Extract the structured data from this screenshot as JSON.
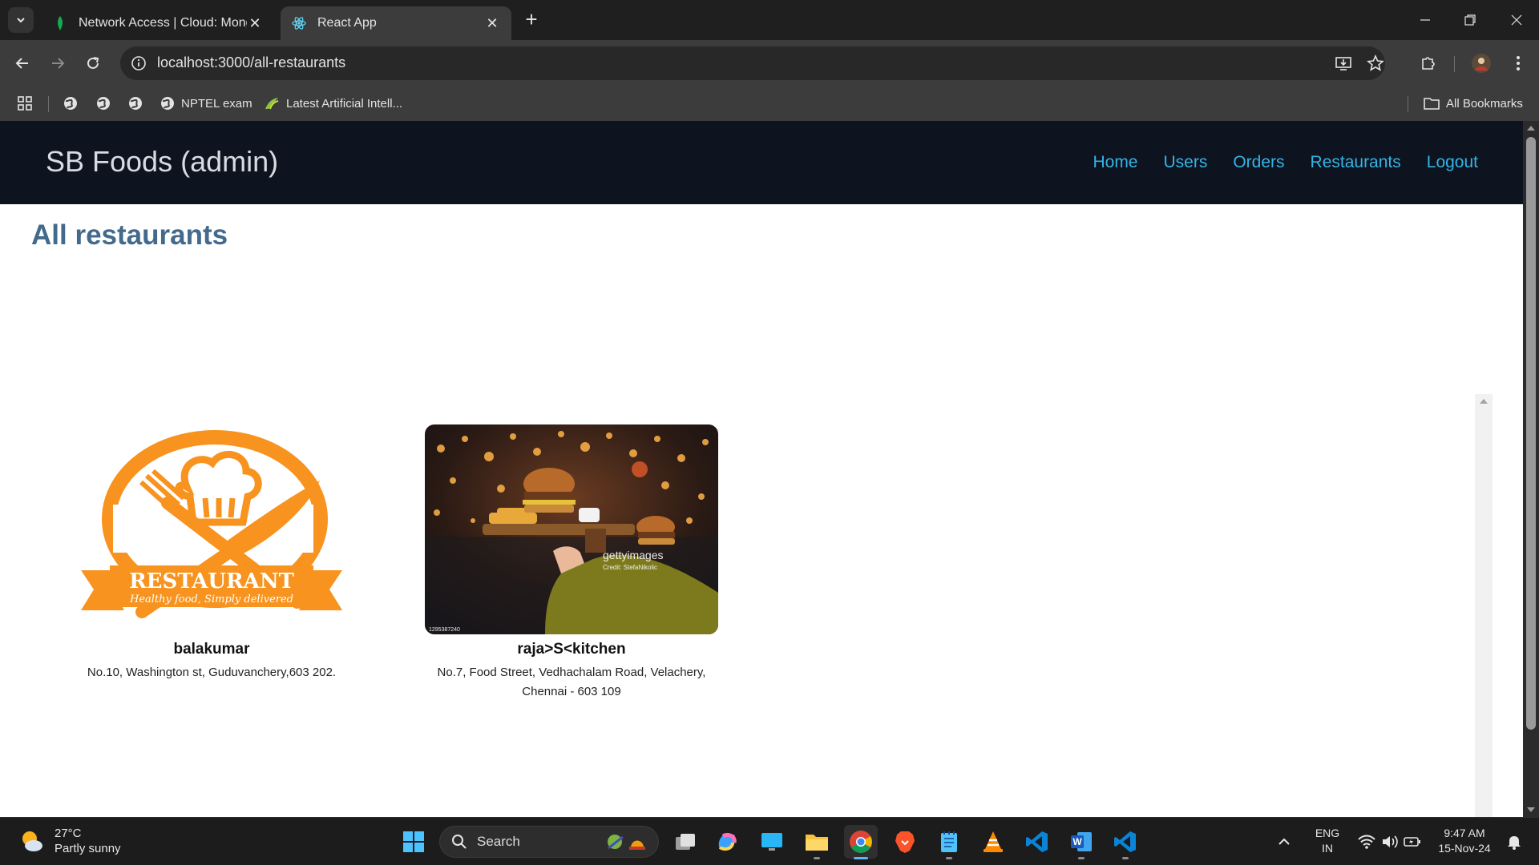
{
  "browser": {
    "tabs": [
      {
        "title": "Network Access | Cloud: MongoDB",
        "active": false
      },
      {
        "title": "React App",
        "active": true
      }
    ],
    "url": "localhost:3000/all-restaurants",
    "bookmarks": [
      {
        "label": ""
      },
      {
        "label": ""
      },
      {
        "label": ""
      },
      {
        "label": "NPTEL exam"
      },
      {
        "label": "Latest Artificial Intell..."
      }
    ],
    "all_bookmarks_label": "All Bookmarks"
  },
  "app": {
    "brand": "SB Foods (admin)",
    "nav": [
      "Home",
      "Users",
      "Orders",
      "Restaurants",
      "Logout"
    ],
    "page_title": "All restaurants",
    "restaurants": [
      {
        "name": "balakumar",
        "address": "No.10, Washington st, Guduvanchery,603 202.",
        "logo_text": "RESTAURANT",
        "logo_tagline": "Healthy food, Simply delivered"
      },
      {
        "name": "raja>S<kitchen",
        "address": "No.7, Food Street, Vedhachalam Road, Velachery, Chennai - 603 109",
        "watermark": "gettyimages",
        "watermark_credit": "Credit: StefaNikolic",
        "image_id": "1295387240"
      }
    ]
  },
  "taskbar": {
    "weather_temp": "27°C",
    "weather_cond": "Partly sunny",
    "search_label": "Search",
    "lang_1": "ENG",
    "lang_2": "IN",
    "time": "9:47 AM",
    "date": "15-Nov-24"
  },
  "colors": {
    "navbar_bg": "#0e1320",
    "nav_link": "#34b4e4",
    "title": "#436a8c",
    "logo_orange": "#f7931e"
  }
}
